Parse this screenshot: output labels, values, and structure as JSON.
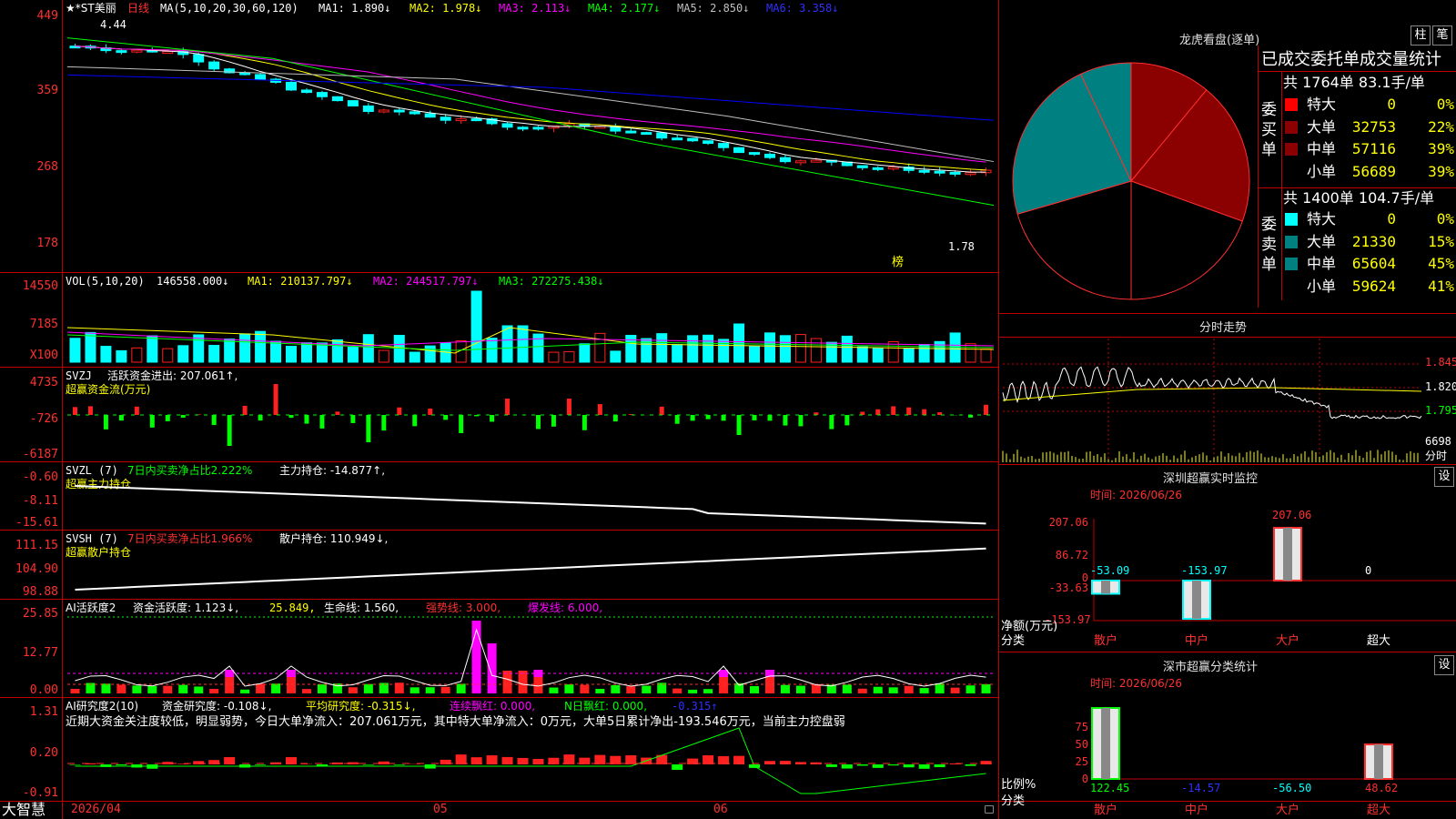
{
  "app": {
    "brand": "大智慧",
    "date_start": "2026/04",
    "month_05": "05",
    "month_06": "06"
  },
  "colors": {
    "up": "#ff2020",
    "down": "#00ffff",
    "ma1": "#ffffff",
    "ma2": "#ffff00",
    "ma3": "#ff00ff",
    "ma4": "#00ff00",
    "ma5": "#c0c0c0",
    "ma6": "#0000ff",
    "axis": "#ff3030",
    "grid": "#c00000"
  },
  "main": {
    "stock": "★*ST美丽",
    "period": "日线",
    "ma_title": "MA(5,10,20,30,60,120)",
    "ma1": "MA1: 1.890↓",
    "ma2": "MA2: 1.978↓",
    "ma3": "MA3: 2.113↓",
    "ma4": "MA4: 2.177↓",
    "ma5": "MA5: 2.850↓",
    "ma6": "MA6: 3.358↓",
    "y_ticks": [
      "449",
      "359",
      "268",
      "178"
    ],
    "high_label": "4.44",
    "low_label": "1.78",
    "bang_label": "榜"
  },
  "vol": {
    "title": "VOL(5,10,20)",
    "value": "146558.000↓",
    "ma1": "MA1: 210137.797↓",
    "ma2": "MA2: 244517.797↓",
    "ma3": "MA3: 272275.438↓",
    "y_ticks": [
      "14550",
      "7185",
      "X100"
    ]
  },
  "svzj": {
    "title": "SVZJ",
    "desc": "活跃资金进出: 207.061↑,",
    "sub": "超赢资金流(万元)",
    "y_ticks": [
      "4735",
      "-726",
      "-6187"
    ]
  },
  "svzl": {
    "title": "SVZL (7)",
    "ratio": "7日内买卖净占比2.222%",
    "hold": "主力持仓: -14.877↑,",
    "sub": "超赢主力持仓",
    "y_ticks": [
      "-0.60",
      "-8.11",
      "-15.61"
    ]
  },
  "svsh": {
    "title": "SVSH (7)",
    "ratio": "7日内买卖净占比1.966%",
    "hold": "散户持仓: 110.949↓,",
    "sub": "超赢散户持仓",
    "y_ticks": [
      "111.15",
      "104.90",
      "98.88"
    ]
  },
  "ai1": {
    "title": "AI活跃度2",
    "act": "资金活跃度: 1.123↓,",
    "v2": "25.849,",
    "life": "生命线: 1.560,",
    "strong": "强势线: 3.000,",
    "burst": "爆发线: 6.000,",
    "y_ticks": [
      "25.85",
      "12.77",
      "0.00"
    ]
  },
  "ai2": {
    "title": "AI研究度2(10)",
    "res": "资金研究度: -0.108↓,",
    "avg": "平均研究度: -0.315↓,",
    "cont": "连续飘红: 0.000,",
    "nday": "N日飘红: 0.000,",
    "last": "-0.315↑",
    "comment": "近期大资金关注度较低，明显弱势，今日大单净流入：207.061万元，其中特大单净流入：0万元，大单5日累计净出-193.546万元，当前主力控盘弱",
    "y_ticks": [
      "1.31",
      "0.20",
      "-0.91"
    ]
  },
  "lhb": {
    "title": "龙虎看盘(逐单)",
    "btn_bar": "柱",
    "btn_pen": "笔",
    "table_title": "已成交委托单成交量统计",
    "buy_header": "共 1764单 83.1手/单",
    "buy_side": "委买单",
    "buy_rows": [
      {
        "label": "特大",
        "value": "0",
        "pct": "0%",
        "color": "#ff0000"
      },
      {
        "label": "大单",
        "value": "32753",
        "pct": "22%",
        "color": "#8b0000"
      },
      {
        "label": "中单",
        "value": "57116",
        "pct": "39%",
        "color": "#8b0000"
      },
      {
        "label": "小单",
        "value": "56689",
        "pct": "39%",
        "color": ""
      }
    ],
    "sell_header": "共 1400单 104.7手/单",
    "sell_side": "委卖单",
    "sell_rows": [
      {
        "label": "特大",
        "value": "0",
        "pct": "0%",
        "color": "#00ffff"
      },
      {
        "label": "大单",
        "value": "21330",
        "pct": "15%",
        "color": "#008080"
      },
      {
        "label": "中单",
        "value": "65604",
        "pct": "45%",
        "color": "#008080"
      },
      {
        "label": "小单",
        "value": "59624",
        "pct": "41%",
        "color": ""
      }
    ],
    "pie_slices": [
      {
        "name": "买大单",
        "value": 11,
        "color": "#8b0000"
      },
      {
        "name": "买中单",
        "value": 19.5,
        "color": "#8b0000"
      },
      {
        "name": "买小单",
        "value": 19.5,
        "color": "#000000"
      },
      {
        "name": "卖小单",
        "value": 20.5,
        "color": "#000000"
      },
      {
        "name": "卖中单",
        "value": 22.5,
        "color": "#008080"
      },
      {
        "name": "卖大单",
        "value": 7,
        "color": "#008080"
      }
    ]
  },
  "fenshi": {
    "title": "分时走势",
    "y_ticks": [
      "1.845",
      "1.820",
      "1.795"
    ],
    "vol_label": "6698",
    "fs_label": "分时"
  },
  "szcy": {
    "title": "深圳超赢实时监控",
    "btn": "设",
    "time": "时间: 2026/06/26",
    "y_ticks": [
      "207.06",
      "86.72",
      "0",
      "-33.63",
      "-153.97"
    ],
    "ylabel": "净额(万元)",
    "xlabel": "分类",
    "categories": [
      "散户",
      "中户",
      "大户",
      "超大"
    ],
    "values": [
      "-53.09",
      "-153.97",
      "207.06",
      "0"
    ],
    "chart_data": {
      "type": "bar",
      "categories": [
        "散户",
        "中户",
        "大户",
        "超大"
      ],
      "values": [
        -53.09,
        -153.97,
        207.06,
        0
      ],
      "ylim": [
        -153.97,
        207.06
      ]
    }
  },
  "sscy": {
    "title": "深市超赢分类统计",
    "btn": "设",
    "time": "时间: 2026/06/26",
    "y_ticks": [
      "75",
      "50",
      "25",
      "0"
    ],
    "ylabel": "比例%",
    "xlabel": "分类",
    "categories": [
      "散户",
      "中户",
      "大户",
      "超大"
    ],
    "values": [
      "122.45",
      "-14.57",
      "-56.50",
      "48.62"
    ],
    "chart_data": {
      "type": "bar",
      "categories": [
        "散户",
        "中户",
        "大户",
        "超大"
      ],
      "values": [
        122.45,
        -14.57,
        -56.5,
        48.62
      ],
      "ylim": [
        0,
        100
      ]
    }
  }
}
